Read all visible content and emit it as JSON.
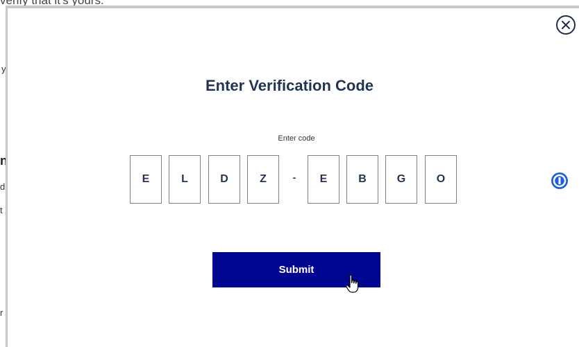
{
  "background": {
    "top_text": "verify that it's yours.",
    "fragments": [
      "y",
      "n",
      "d",
      "t",
      "r"
    ]
  },
  "modal": {
    "close_icon": "close-icon",
    "title": "Enter Verification Code",
    "code_label": "Enter code",
    "code_chars": [
      "E",
      "L",
      "D",
      "Z",
      "E",
      "B",
      "G",
      "O"
    ],
    "separator": "-",
    "password_manager_icon": "password-manager-icon",
    "submit_label": "Submit"
  },
  "colors": {
    "title": "#1f3553",
    "submit_bg": "#00068f",
    "password_manager": "#1a62d6"
  }
}
